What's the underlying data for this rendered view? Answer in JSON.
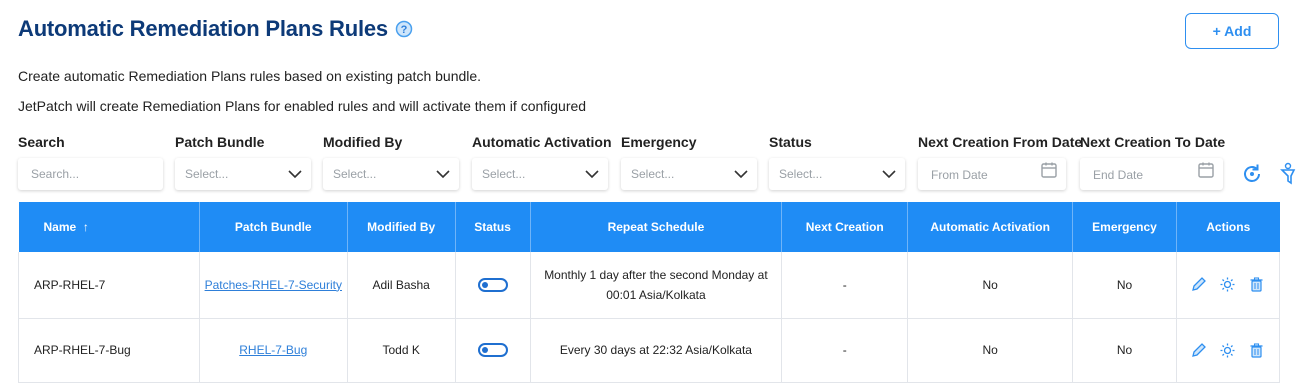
{
  "header": {
    "title": "Automatic Remediation Plans Rules",
    "add_label": "+ Add"
  },
  "description": {
    "line1": "Create automatic Remediation Plans rules based on existing patch bundle.",
    "line2": "JetPatch will create Remediation Plans for enabled rules and will activate them if configured"
  },
  "filters": {
    "search": {
      "label": "Search",
      "placeholder": "Search..."
    },
    "patch_bundle": {
      "label": "Patch Bundle",
      "placeholder": "Select..."
    },
    "modified_by": {
      "label": "Modified By",
      "placeholder": "Select..."
    },
    "automatic_activation": {
      "label": "Automatic Activation",
      "placeholder": "Select..."
    },
    "emergency": {
      "label": "Emergency",
      "placeholder": "Select..."
    },
    "status": {
      "label": "Status",
      "placeholder": "Select..."
    },
    "from_date": {
      "label": "Next Creation From Date",
      "placeholder": "From Date"
    },
    "to_date": {
      "label": "Next Creation To Date",
      "placeholder": "End Date"
    }
  },
  "table": {
    "columns": {
      "name": "Name",
      "name_sort": "↑",
      "patch_bundle": "Patch Bundle",
      "modified_by": "Modified By",
      "status": "Status",
      "repeat_schedule": "Repeat Schedule",
      "next_creation": "Next Creation",
      "automatic_activation": "Automatic Activation",
      "emergency": "Emergency",
      "actions": "Actions"
    },
    "rows": [
      {
        "name": "ARP-RHEL-7",
        "patch_bundle": "Patches-RHEL-7-Security",
        "modified_by": "Adil Basha",
        "status_enabled": true,
        "schedule_line1": "Monthly 1 day after the second Monday at",
        "schedule_line2": "00:01 Asia/Kolkata",
        "next_creation": "-",
        "automatic_activation": "No",
        "emergency": "No"
      },
      {
        "name": "ARP-RHEL-7-Bug",
        "patch_bundle": "RHEL-7-Bug",
        "modified_by": "Todd K",
        "status_enabled": true,
        "schedule_line1": "Every 30 days at 22:32 Asia/Kolkata",
        "next_creation": "-",
        "automatic_activation": "No",
        "emergency": "No"
      }
    ]
  },
  "icons": {
    "help": "help-icon",
    "refresh": "refresh-icon",
    "clear_filters": "clear-filters-icon",
    "edit": "edit-icon",
    "run": "run-icon",
    "delete": "delete-icon"
  },
  "colors": {
    "title": "#0d3a78",
    "accent": "#1f8cf5",
    "link": "#2e7fd9"
  }
}
